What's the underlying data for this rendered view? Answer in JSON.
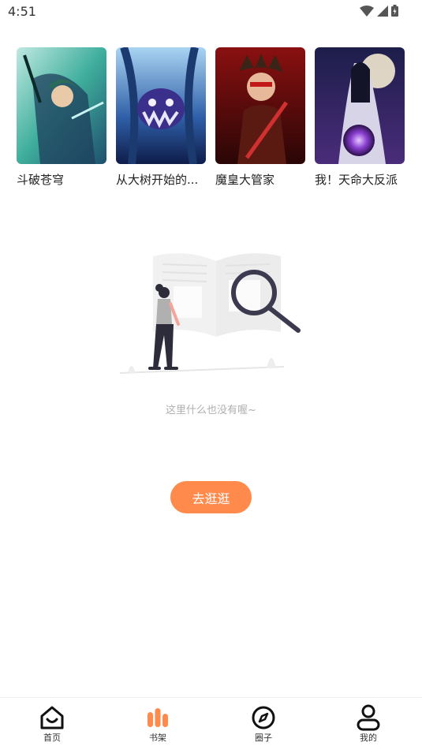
{
  "status_bar": {
    "time": "4:51"
  },
  "recommended": [
    {
      "title": "斗破苍穹"
    },
    {
      "title": "从大树开始的..."
    },
    {
      "title": "魔皇大管家"
    },
    {
      "title": "我！天命大反派"
    }
  ],
  "empty_state": {
    "message": "这里什么也没有喔~",
    "button_label": "去逛逛"
  },
  "bottom_nav": [
    {
      "label": "首页",
      "icon": "home-icon"
    },
    {
      "label": "书架",
      "icon": "bookshelf-icon",
      "active": true
    },
    {
      "label": "圈子",
      "icon": "compass-icon"
    },
    {
      "label": "我的",
      "icon": "profile-icon"
    }
  ],
  "colors": {
    "accent": "#ff8a4c",
    "muted_text": "#b0b0b0"
  }
}
